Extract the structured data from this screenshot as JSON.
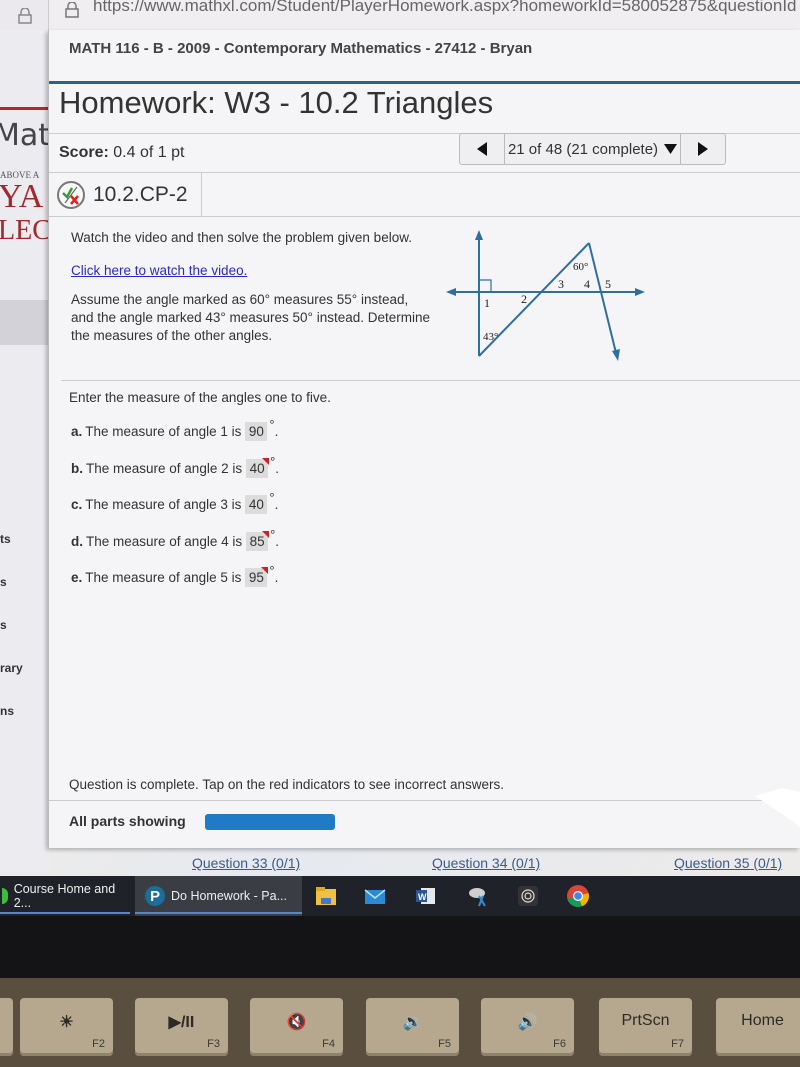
{
  "browser": {
    "url": "https://www.mathxl.com/Student/PlayerHomework.aspx?homeworkId=580052875&questionId"
  },
  "background_site": {
    "logo_text": "Math",
    "tagline": "ABOVE A",
    "college_line1": "YA",
    "college_line2": "LEC",
    "nav_fragments": [
      "ts",
      "s",
      "s",
      "rary",
      "ns"
    ]
  },
  "course": {
    "title": "MATH 116 - B - 2009 - Contemporary Mathematics - 27412 - Bryan"
  },
  "homework": {
    "title": "Homework: W3 - 10.2 Triangles",
    "score_label": "Score:",
    "score_value": "0.4 of 1 pt",
    "question_nav": {
      "prev_icon": "triangle-left",
      "position": "21 of 48 (21 complete)",
      "dropdown_icon": "triangle-down",
      "next_icon": "triangle-right"
    },
    "question_id": "10.2.CP-2",
    "question_status_icon": "partial-credit-icon"
  },
  "problem": {
    "instruction": "Watch the video and then solve the problem given below.",
    "video_link": "Click here to watch the video.",
    "statement_lines": [
      "Assume the angle marked as 60° measures 55° instead,",
      "and the angle marked 43° measures 50° instead. Determine",
      "the measures of the other angles."
    ],
    "figure": {
      "angle_labels": [
        "1",
        "2",
        "3",
        "4",
        "5"
      ],
      "given_angles": [
        "60°",
        "43°"
      ],
      "line_color": "#2f6f9f"
    }
  },
  "answers": {
    "prompt": "Enter the measure of the angles one to five.",
    "items": [
      {
        "letter": "a.",
        "text": "The measure of angle 1 is",
        "value": "90",
        "correct": true
      },
      {
        "letter": "b.",
        "text": "The measure of angle 2 is",
        "value": "40",
        "correct": false
      },
      {
        "letter": "c.",
        "text": "The measure of angle 3 is",
        "value": "40",
        "correct": true
      },
      {
        "letter": "d.",
        "text": "The measure of angle 4 is",
        "value": "85",
        "correct": false
      },
      {
        "letter": "e.",
        "text": "The measure of angle 5 is",
        "value": "95",
        "correct": false
      }
    ],
    "degree_symbol": "°",
    "period": "."
  },
  "footer": {
    "complete_message": "Question is complete. Tap on the red indicators to see incorrect answers.",
    "parts_label": "All parts showing",
    "parts_bar_color": "#1f7bc4"
  },
  "below_links": [
    "Question 33 (0/1)",
    "Question 34 (0/1)",
    "Question 35 (0/1)"
  ],
  "taskbar": {
    "tasks": [
      {
        "label": "Course Home and 2...",
        "icon": "green-app-icon"
      },
      {
        "label": "Do Homework - Pa...",
        "icon": "pearson-icon"
      }
    ],
    "pinned": [
      "file-explorer-icon",
      "mail-icon",
      "word-icon",
      "snipping-tool-icon",
      "audio-app-icon",
      "chrome-icon"
    ]
  },
  "keyboard": {
    "keys": [
      {
        "symbol": "☀",
        "fn": "F2"
      },
      {
        "symbol": "▶/II",
        "fn": "F3"
      },
      {
        "symbol": "🔇",
        "fn": "F4"
      },
      {
        "symbol": "🔉",
        "fn": "F5"
      },
      {
        "symbol": "🔊",
        "fn": "F6"
      },
      {
        "symbol": "PrtScn",
        "fn": "F7"
      },
      {
        "symbol": "Home",
        "fn": ""
      }
    ]
  }
}
